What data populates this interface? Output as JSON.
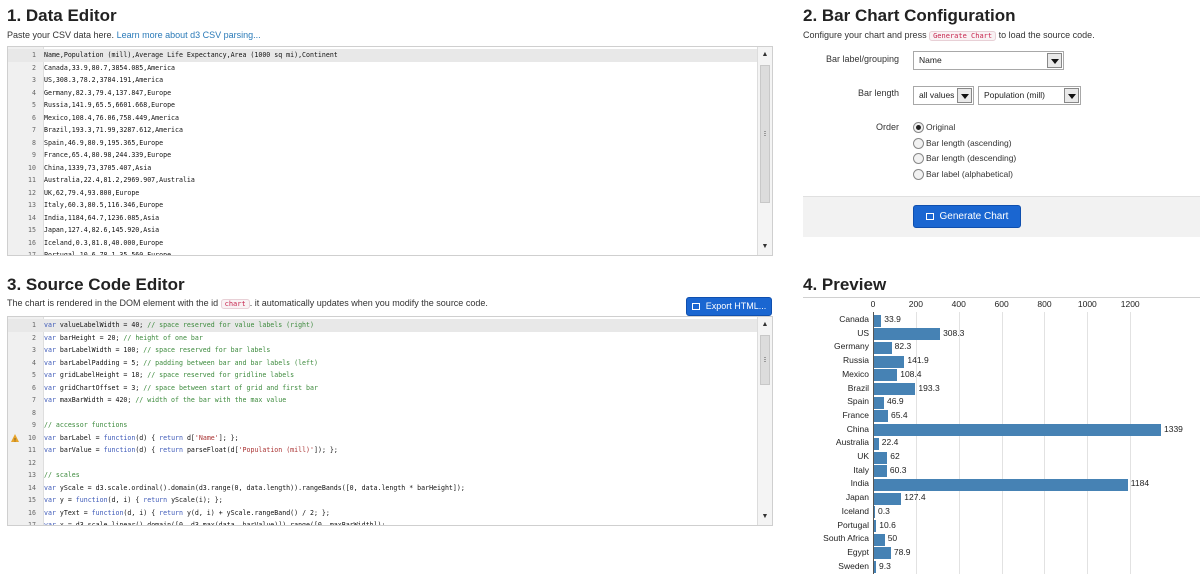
{
  "data_editor": {
    "title": "1. Data Editor",
    "subtitle": "Paste your CSV data here.",
    "learn_link": "Learn more about d3 CSV parsing...",
    "lines": [
      "Name,Population (mill),Average Life Expectancy,Area (1000 sq mi),Continent",
      "Canada,33.9,80.7,3854.085,America",
      "US,308.3,78.2,3784.191,America",
      "Germany,82.3,79.4,137.847,Europe",
      "Russia,141.9,65.5,6601.668,Europe",
      "Mexico,108.4,76.06,758.449,America",
      "Brazil,193.3,71.99,3287.612,America",
      "Spain,46.9,80.9,195.365,Europe",
      "France,65.4,80.98,244.339,Europe",
      "China,1339,73,3705.407,Asia",
      "Australia,22.4,81.2,2969.907,Australia",
      "UK,62,79.4,93.800,Europe",
      "Italy,60.3,80.5,116.346,Europe",
      "India,1184,64.7,1236.085,Asia",
      "Japan,127.4,82.6,145.920,Asia",
      "Iceland,0.3,81.8,40.000,Europe",
      "Portugal,10.6,78.1,35.560,Europe"
    ]
  },
  "source_editor": {
    "title": "3. Source Code Editor",
    "subtitle_before": "The chart is rendered in the DOM element with the id",
    "subtitle_code": "chart",
    "subtitle_after": ". it automatically updates when you modify the source code.",
    "export_label": "Export HTML...",
    "warning_line": 10,
    "lines": [
      "var valueLabelWidth = 40; // space reserved for value labels (right)",
      "var barHeight = 20; // height of one bar",
      "var barLabelWidth = 100; // space reserved for bar labels",
      "var barLabelPadding = 5; // padding between bar and bar labels (left)",
      "var gridLabelHeight = 18; // space reserved for gridline labels",
      "var gridChartOffset = 3; // space between start of grid and first bar",
      "var maxBarWidth = 420; // width of the bar with the max value",
      "",
      "// accessor functions",
      "var barLabel = function(d) { return d['Name']; };",
      "var barValue = function(d) { return parseFloat(d['Population (mill)']); };",
      "",
      "// scales",
      "var yScale = d3.scale.ordinal().domain(d3.range(0, data.length)).rangeBands([0, data.length * barHeight]);",
      "var y = function(d, i) { return yScale(i); };",
      "var yText = function(d, i) { return y(d, i) + yScale.rangeBand() / 2; };",
      "var x = d3.scale.linear().domain([0, d3.max(data, barValue)]).range([0, maxBarWidth]);"
    ]
  },
  "config": {
    "title": "2. Bar Chart Configuration",
    "subtitle_before": "Configure your chart and press",
    "subtitle_code": "Generate Chart",
    "subtitle_after": "to load the source code.",
    "grouping_label": "Bar label/grouping",
    "grouping_value": "Name",
    "length_label": "Bar length",
    "length_agg": "all values",
    "length_value": "Population (mill)",
    "order_label": "Order",
    "order_options": [
      "Original",
      "Bar length (ascending)",
      "Bar length (descending)",
      "Bar label (alphabetical)"
    ],
    "order_selected": 0,
    "generate_label": "Generate Chart"
  },
  "preview": {
    "title": "4. Preview"
  },
  "chart_data": {
    "type": "bar",
    "orientation": "horizontal",
    "categories": [
      "Canada",
      "US",
      "Germany",
      "Russia",
      "Mexico",
      "Brazil",
      "Spain",
      "France",
      "China",
      "Australia",
      "UK",
      "Italy",
      "India",
      "Japan",
      "Iceland",
      "Portugal",
      "South Africa",
      "Egypt",
      "Sweden"
    ],
    "values": [
      33.9,
      308.3,
      82.3,
      141.9,
      108.4,
      193.3,
      46.9,
      65.4,
      1339,
      22.4,
      62,
      60.3,
      1184,
      127.4,
      0.3,
      10.6,
      50,
      78.9,
      9.3
    ],
    "value_labels": [
      "33.9",
      "308.3",
      "82.3",
      "141.9",
      "108.4",
      "193.3",
      "46.9",
      "65.4",
      "1339",
      "22.4",
      "62",
      "60.3",
      "1184",
      "127.4",
      "0.3",
      "10.6",
      "50",
      "78.9",
      "9.3"
    ],
    "x_ticks": [
      "0",
      "200",
      "400",
      "600",
      "800",
      "1000",
      "1200"
    ],
    "xlim": [
      0,
      1339
    ],
    "bar_color": "#4682b4",
    "grid": true
  }
}
